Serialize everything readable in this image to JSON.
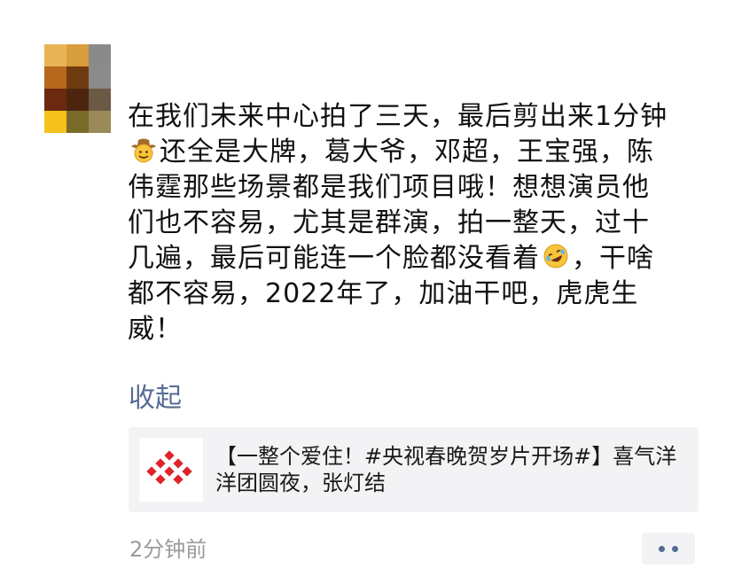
{
  "avatar": {
    "colors": [
      "#e7b456",
      "#d89e3d",
      "#8a8a8a",
      "#b7681c",
      "#6f3c0f",
      "#8b8b8b",
      "#6b2a0f",
      "#4d250f",
      "#6b5845",
      "#f4c21b",
      "#7a6a2a",
      "#9a8a5a"
    ]
  },
  "post": {
    "lines": [
      "在我们未来中心拍了三天，最后剪出来1分钟",
      "还全是大牌，葛大爷，邓超，王宝强，陈",
      "伟霆那些场景都是我们项目哦！想想演员他",
      "们也不容易，尤其是群演，拍一整天，过十",
      "几遍，最后可能连一个脸都没看着",
      "，干啥",
      "都不容易，2022年了，加油干吧，虎虎生",
      "威！"
    ],
    "emoji_1": "cowboy-face-emoji",
    "emoji_2": "rolling-laughing-emoji",
    "collapse_label": "收起"
  },
  "share": {
    "title": "【一整个爱住！#央视春晚贺岁片开场#】喜气洋洋团圆夜，张灯结",
    "logo": "red-diamond-logo-icon"
  },
  "timestamp": "2分钟前",
  "more_button": "more-dots-icon",
  "colors": {
    "link": "#586b95",
    "muted": "#9b9b9b",
    "card_bg": "#f3f3f5",
    "logo_red": "#e0242b"
  }
}
